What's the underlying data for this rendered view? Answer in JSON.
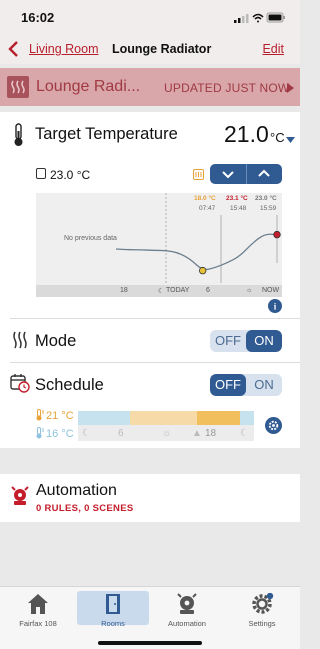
{
  "status_bar": {
    "time": "16:02"
  },
  "nav": {
    "back_label": "Living Room",
    "title": "Lounge Radiator",
    "edit_label": "Edit"
  },
  "banner": {
    "title": "Lounge Radi...",
    "status": "UPDATED JUST NOW"
  },
  "target": {
    "label": "Target Temperature",
    "value": "21.0",
    "unit": "°C"
  },
  "current": {
    "value": "23.0 °C"
  },
  "chart_data": {
    "type": "line",
    "empty_label": "No previous data",
    "x_tick_labels": [
      "18",
      "TODAY",
      "6",
      "NOW"
    ],
    "annotations": [
      {
        "temp": "18.0 °C",
        "time": "07:47",
        "color": "#e8a23a"
      },
      {
        "temp": "23.1 °C",
        "time": "15:48",
        "color": "#c41e2c"
      },
      {
        "temp": "23.0 °C",
        "time": "15:59",
        "color": "#777777"
      }
    ],
    "series": [
      {
        "values": [
          21.0,
          20.9,
          20.9,
          20.8,
          20.8,
          20.5,
          19.6,
          18.0,
          18.4,
          19.1,
          20.0,
          21.8,
          23.1,
          23.0
        ]
      }
    ],
    "marker_points": [
      {
        "time": "07:47",
        "value": 18.0,
        "color": "#e8c33a"
      },
      {
        "time": "15:59",
        "value": 23.0,
        "color": "#c41e2c"
      }
    ]
  },
  "mode": {
    "label": "Mode",
    "off_label": "OFF",
    "on_label": "ON",
    "state": "ON"
  },
  "schedule": {
    "label": "Schedule",
    "off_label": "OFF",
    "on_label": "ON",
    "state": "OFF",
    "warm_temp": "21 °C",
    "cool_temp": "16 °C",
    "times": [
      "6",
      "18"
    ],
    "colors": {
      "cool": "#c6e2ef",
      "warm": "#f6dba9",
      "hot": "#f2bf5d"
    }
  },
  "automation": {
    "label": "Automation",
    "summary": "0 RULES, 0 SCENES"
  },
  "tabs": [
    {
      "label": "Fairfax 108",
      "icon": "home-icon"
    },
    {
      "label": "Rooms",
      "icon": "door-icon"
    },
    {
      "label": "Automation",
      "icon": "robot-icon"
    },
    {
      "label": "Settings",
      "icon": "gear-icon"
    }
  ],
  "colors": {
    "accent_red": "#c41e2c",
    "accent_blue": "#305a92"
  }
}
